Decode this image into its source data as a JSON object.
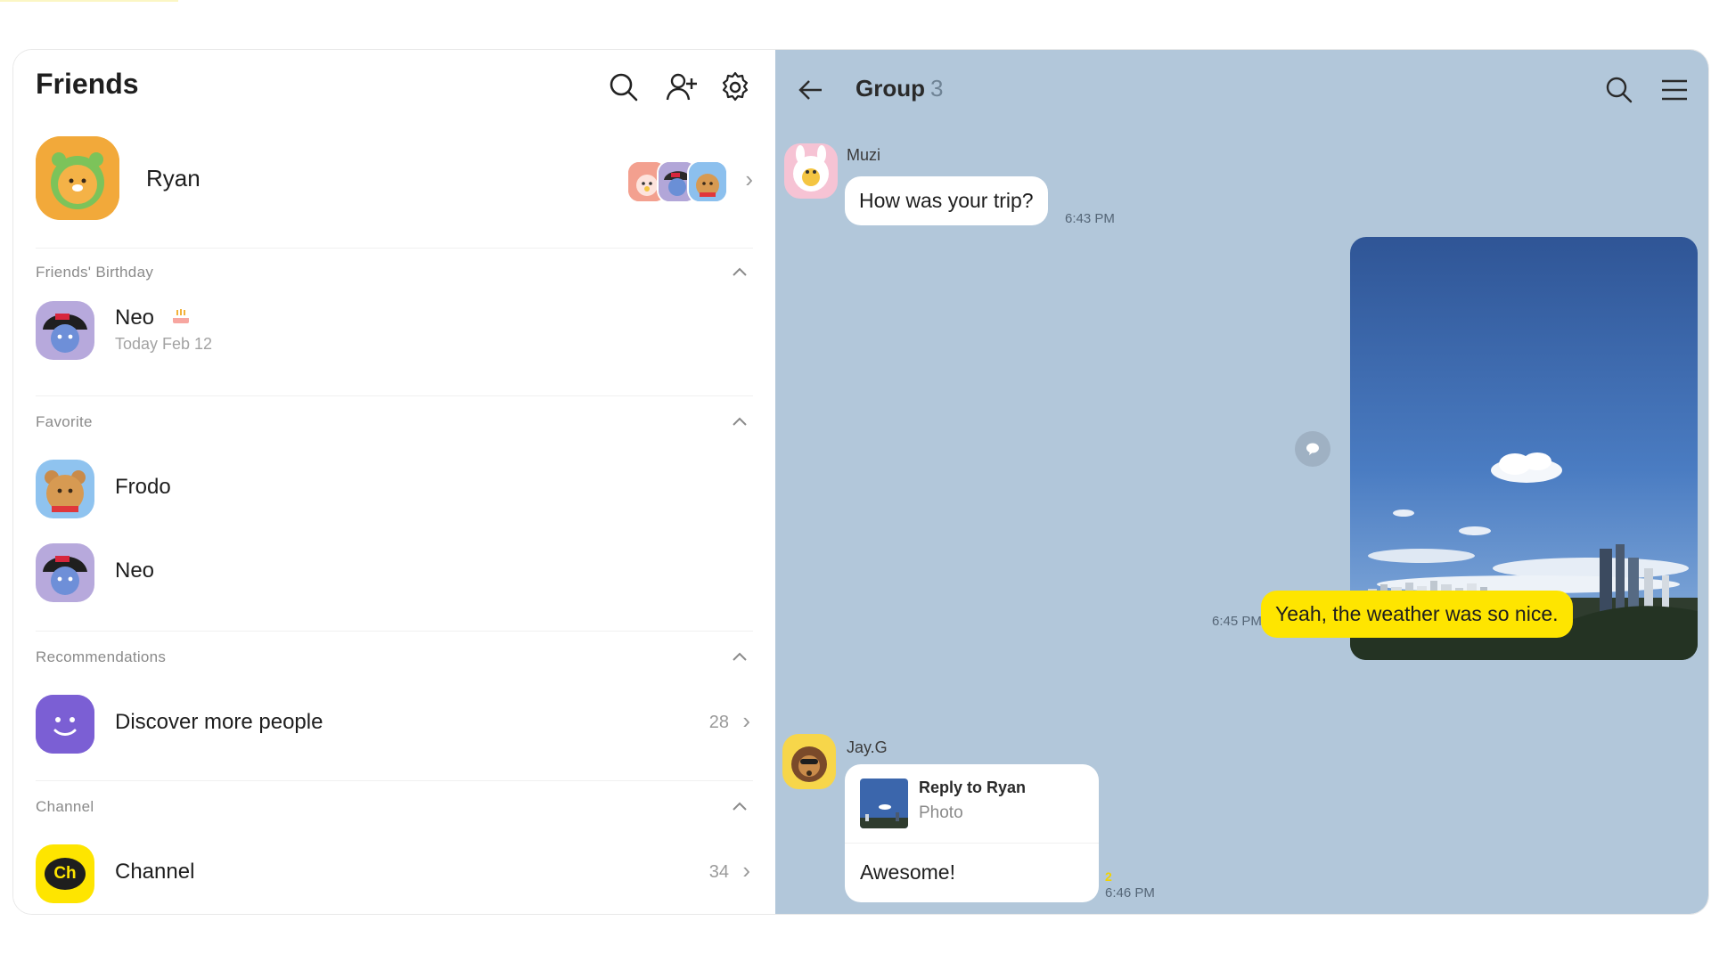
{
  "friends_panel": {
    "title": "Friends",
    "my_profile": {
      "name": "Ryan"
    },
    "sections": {
      "birthday": {
        "title": "Friends' Birthday",
        "friend": {
          "name": "Neo",
          "sub": "Today Feb 12"
        }
      },
      "favorite": {
        "title": "Favorite",
        "friends": [
          {
            "name": "Frodo"
          },
          {
            "name": "Neo"
          }
        ]
      },
      "recommendations": {
        "title": "Recommendations",
        "item": {
          "name": "Discover more people",
          "count": "28"
        }
      },
      "channel": {
        "title": "Channel",
        "item": {
          "name": "Channel",
          "count": "34",
          "logo_text": "Ch"
        }
      }
    }
  },
  "chat": {
    "title": "Group",
    "member_count": "3",
    "messages": [
      {
        "sender": "Muzi",
        "text": "How was your trip?",
        "time": "6:43 PM"
      },
      {
        "sender": "Me",
        "type": "photo",
        "text": "Yeah, the weather was so nice.",
        "time": "6:45 PM"
      },
      {
        "sender": "Jay.G",
        "reply_to": "Reply to Ryan",
        "reply_type": "Photo",
        "text": "Awesome!",
        "time": "6:46 PM",
        "unread": "2"
      }
    ]
  },
  "icons": [
    "search-icon",
    "add-friend-icon",
    "settings-icon",
    "back-arrow-icon",
    "menu-icon",
    "chevron-up-icon",
    "chevron-right-icon",
    "share-bubble-icon",
    "birthday-cake-icon"
  ],
  "colors": {
    "chat_bg": "#b2c7da",
    "my_bubble": "#fee500",
    "their_bubble": "#ffffff",
    "accent_purple": "#7b5fd4"
  }
}
